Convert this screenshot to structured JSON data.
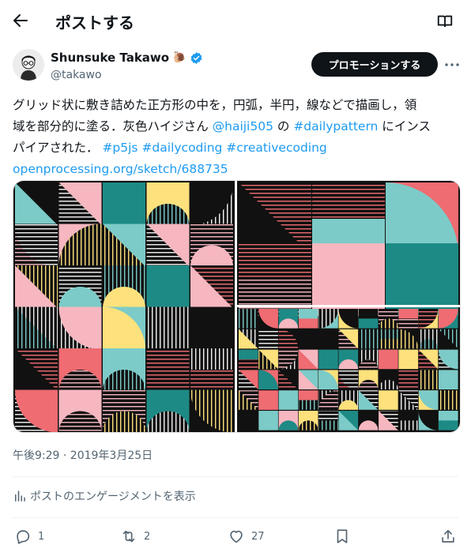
{
  "header": {
    "title": "ポストする"
  },
  "author": {
    "name": "Shunsuke Takawo",
    "handle": "@takawo",
    "emoji": "🐌"
  },
  "promote_label": "プロモーションする",
  "tweet": {
    "line1": "グリッド状に敷き詰めた正方形の中を，円弧，半円，線などで描画し，領",
    "line2_a": "域を部分的に塗る．灰色ハイジさん ",
    "line2_mention": "@haiji505",
    "line2_b": " の ",
    "line2_hashtag": "#dailypattern",
    "line2_c": " にインス",
    "line3_a": "パイアされた． ",
    "line3_tags": "#p5js #dailycoding #creativecoding",
    "line4_link": "openprocessing.org/sketch/688735"
  },
  "timestamp": "午後9:29 · 2019年3月25日",
  "engagements_label": "ポストのエンゲージメントを表示",
  "actions": {
    "replies": "1",
    "reposts": "2",
    "likes": "27"
  },
  "colors": {
    "teal": "#1e8a85",
    "aqua": "#7ccbc8",
    "pink": "#f6b7c0",
    "coral": "#ee6c72",
    "yellow": "#fde17c",
    "black": "#111111",
    "link": "#1d9bf0"
  }
}
